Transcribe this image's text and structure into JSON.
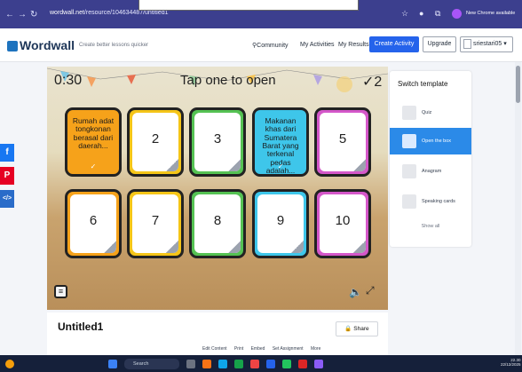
{
  "browser": {
    "url_host": "wordwall.net",
    "url_path": "/resource/104634487/untitled1",
    "profile_label": "New Chrome available"
  },
  "header": {
    "logo": "Wordwall",
    "tagline": "Create better lessons quicker",
    "nav": [
      "Community",
      "My Activities",
      "My Results"
    ],
    "create_activity": "Create Activity",
    "upgrade": "Upgrade",
    "user": "sriestari05"
  },
  "side_share": [
    "f",
    "P",
    "</>"
  ],
  "game": {
    "timer": "0:30",
    "title": "Tap one to open",
    "opened_count": "2",
    "cards": [
      {
        "label": "Rumah adat tongkonan berasal dari daerah...",
        "open": true,
        "color": "#f6a21a"
      },
      {
        "label": "2",
        "open": false,
        "color": "#f5c518"
      },
      {
        "label": "3",
        "open": false,
        "color": "#55c253"
      },
      {
        "label": "Makanan khas dari Sumatera Barat yang terkenal pedas adalah...",
        "open": true,
        "color": "#3ec6ea"
      },
      {
        "label": "5",
        "open": false,
        "color": "#d457c9"
      },
      {
        "label": "6",
        "open": false,
        "color": "#f6a21a"
      },
      {
        "label": "7",
        "open": false,
        "color": "#f5c518"
      },
      {
        "label": "8",
        "open": false,
        "color": "#55c253"
      },
      {
        "label": "9",
        "open": false,
        "color": "#3ec6ea"
      },
      {
        "label": "10",
        "open": false,
        "color": "#d457c9"
      }
    ]
  },
  "panel": {
    "title": "Switch template",
    "templates": [
      {
        "label": "Quiz",
        "active": false
      },
      {
        "label": "Open the box",
        "active": true
      },
      {
        "label": "Anagram",
        "active": false
      },
      {
        "label": "Speaking cards",
        "active": false
      }
    ],
    "show_all": "Show all"
  },
  "activity": {
    "title": "Untitled1",
    "share": "Share",
    "actions": [
      "Edit Content",
      "Print",
      "Embed",
      "Set Assignment",
      "More"
    ]
  },
  "taskbar": {
    "search": "Search",
    "time": "22.30",
    "date": "22/12/2025"
  }
}
